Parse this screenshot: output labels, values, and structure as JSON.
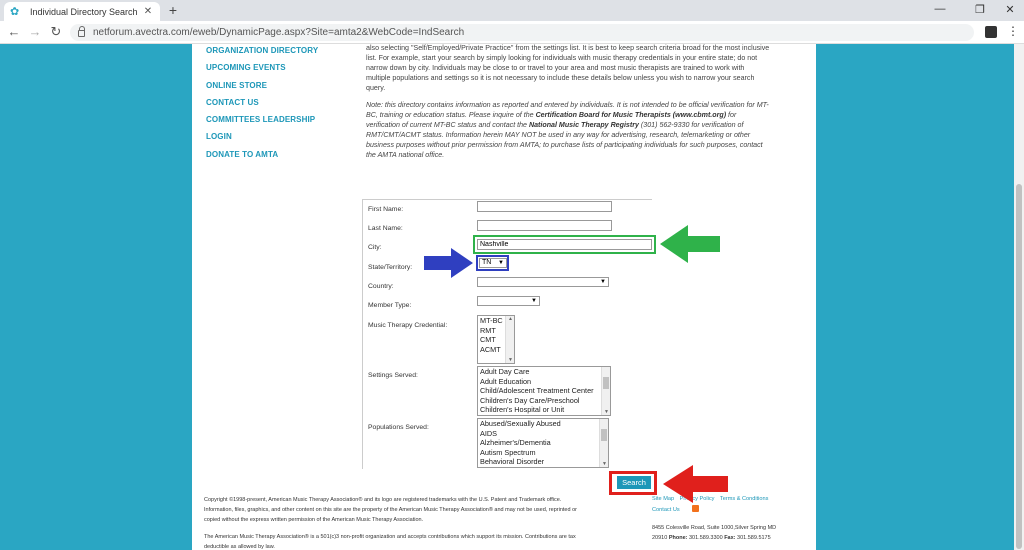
{
  "browser": {
    "tab_title": "Individual Directory Search",
    "url": "netforum.avectra.com/eweb/DynamicPage.aspx?Site=amta2&WebCode=IndSearch"
  },
  "sidebar": {
    "items": [
      {
        "label": "ORGANIZATION DIRECTORY"
      },
      {
        "label": "UPCOMING EVENTS"
      },
      {
        "label": "ONLINE STORE"
      },
      {
        "label": "CONTACT US"
      },
      {
        "label": "COMMITTEES LEADERSHIP"
      },
      {
        "label": "LOGIN"
      },
      {
        "label": "DONATE TO AMTA"
      }
    ]
  },
  "content": {
    "intro_lines": [
      "also selecting \"Self/Employed/Private Practice\" from the settings list. It is best to keep search criteria broad for the most inclusive",
      "list. For example, start your search by simply looking for individuals with music therapy credentials in your entire state; do not",
      "narrow down by city. Individuals may be close to or travel to your area and most music therapists are trained to work with",
      "multiple populations and settings so it is not necessary to include these details below unless you wish to narrow your search",
      "query."
    ],
    "note": {
      "l1": "Note: this directory contains information as reported and entered by individuals. It is not intended to be official verification for MT-",
      "l2a": "BC, training or education status. Please inquire of the ",
      "l2b": "Certification Board for Music Therapists (www.cbmt.org)",
      "l2c": " for",
      "l3a": "verification of current MT-BC status and contact the ",
      "l3b": "National Music Therapy Registry",
      "l3c": " (301) 562-9330 for verification of",
      "l4": "RMT/CMT/ACMT status.  Information herein MAY NOT be used in any way for advertising, research, telemarketing or other",
      "l5": "business purposes without prior permission from AMTA; to purchase lists of participating individuals for such purposes, contact",
      "l6": "the AMTA national office."
    }
  },
  "form": {
    "first_name_label": "First Name:",
    "first_name_value": "",
    "last_name_label": "Last Name:",
    "last_name_value": "",
    "city_label": "City:",
    "city_value": "Nashville",
    "state_label": "State/Territory:",
    "state_value": "TN",
    "country_label": "Country:",
    "country_value": "",
    "member_type_label": "Member Type:",
    "member_type_value": "",
    "credential_label": "Music Therapy Credential:",
    "credential_options": [
      "MT-BC",
      "RMT",
      "CMT",
      "ACMT"
    ],
    "settings_label": "Settings Served:",
    "settings_options": [
      "Adult Day Care",
      "Adult Education",
      "Child/Adolescent Treatment Center",
      "Children's Day Care/Preschool",
      "Children's Hospital or Unit"
    ],
    "populations_label": "Populations Served:",
    "populations_options": [
      "Abused/Sexually Abused",
      "AIDS",
      "Alzheimer's/Dementia",
      "Autism Spectrum",
      "Behavioral Disorder"
    ],
    "search_label": "Search"
  },
  "footer": {
    "copyright_lines": [
      "Copyright ©1998-present, American Music Therapy Association® and its logo are registered trademarks with the U.S. Patent and Trademark office.",
      "Information, files, graphics, and other content on this site are the property of the American Music Therapy Association® and may not be used, reprinted or",
      "copied without the express written permission of the American Music Therapy Association.",
      "",
      "The American Music Therapy Association® is a 501(c)3 non-profit organization and accepts contributions which support its mission. Contributions are tax",
      "deductible as allowed by law."
    ],
    "links": [
      "Site Map",
      "Privacy Policy",
      "Terms & Conditions"
    ],
    "contact_link": "Contact Us",
    "address": "8455 Colesville Road, Suite 1000,Silver Spring MD",
    "zip": "20910",
    "phone_label": "Phone:",
    "phone": "301.589.3300",
    "fax_label": "Fax:",
    "fax": "301.589.5175"
  },
  "annotations": {
    "city_highlight_color": "#2fb24a",
    "state_highlight_color": "#2f3fc0",
    "search_highlight_color": "#e0201c"
  }
}
